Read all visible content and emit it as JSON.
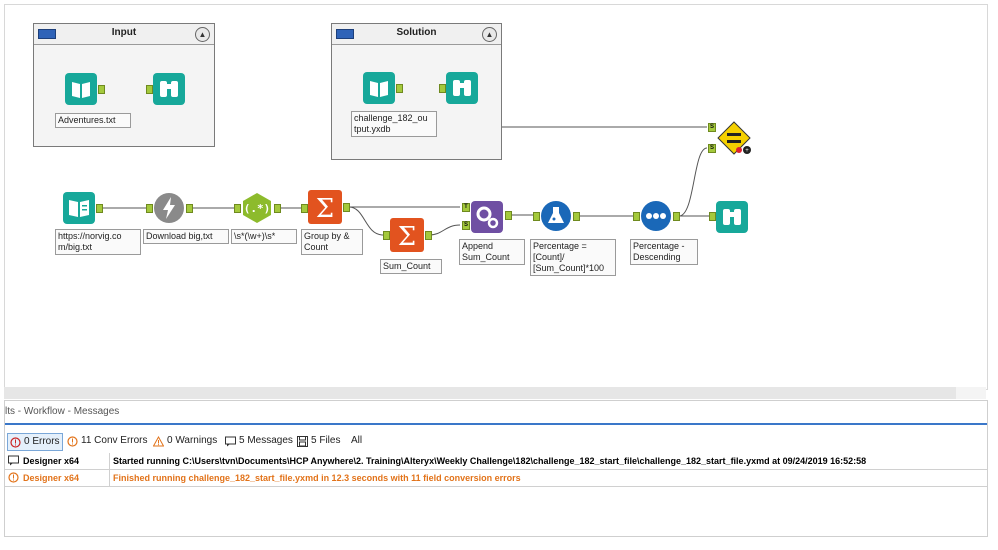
{
  "canvas": {
    "containers": [
      {
        "title": "Input"
      },
      {
        "title": "Solution"
      }
    ],
    "tools": {
      "input_adventures": {
        "label": "Adventures.txt"
      },
      "browse_input": {
        "label": ""
      },
      "input_solution": {
        "label": "challenge_182_ou\ntput.yxdb"
      },
      "browse_solution": {
        "label": ""
      },
      "text_input_url": {
        "label": "https://norvig.co\nm/big.txt"
      },
      "download": {
        "label": "Download big,txt"
      },
      "regex": {
        "label": "\\s*(\\w+)\\s*"
      },
      "summarize_group": {
        "label": "Group by &\nCount"
      },
      "summarize_sum": {
        "label": "Sum_Count"
      },
      "append_fields": {
        "label": "Append\nSum_Count"
      },
      "formula": {
        "label": "Percentage =\n[Count]/\n[Sum_Count]*100"
      },
      "sort": {
        "label": "Percentage -\nDescending"
      },
      "browse_output": {
        "label": ""
      }
    },
    "anchors": {
      "target": "T",
      "source": "S",
      "left": "L",
      "right": "R"
    },
    "icon_colors": {
      "input": "#17a89a",
      "download": "#8a8a8a",
      "regex": "#8dbb2c",
      "summarize": "#e2531f",
      "append": "#6f4fa3",
      "formula": "#1a68b8",
      "sort": "#1a68b8",
      "test": "#f5d000"
    }
  },
  "panel": {
    "title": "lts - Workflow - Messages",
    "filters": {
      "errors": "0 Errors",
      "conv_errors": "11 Conv Errors",
      "warnings": "0 Warnings",
      "messages": "5 Messages",
      "files": "5 Files",
      "all": "All"
    },
    "messages": [
      {
        "source": "Designer x64",
        "text": "Started running C:\\Users\\tvn\\Documents\\HCP Anywhere\\2. Training\\Alteryx\\Weekly Challenge\\182\\challenge_182_start_file\\challenge_182_start_file.yxmd at 09/24/2019 16:52:58"
      },
      {
        "source": "Designer x64",
        "text": "Finished running challenge_182_start_file.yxmd in 12.3 seconds with 11 field conversion errors"
      }
    ]
  }
}
